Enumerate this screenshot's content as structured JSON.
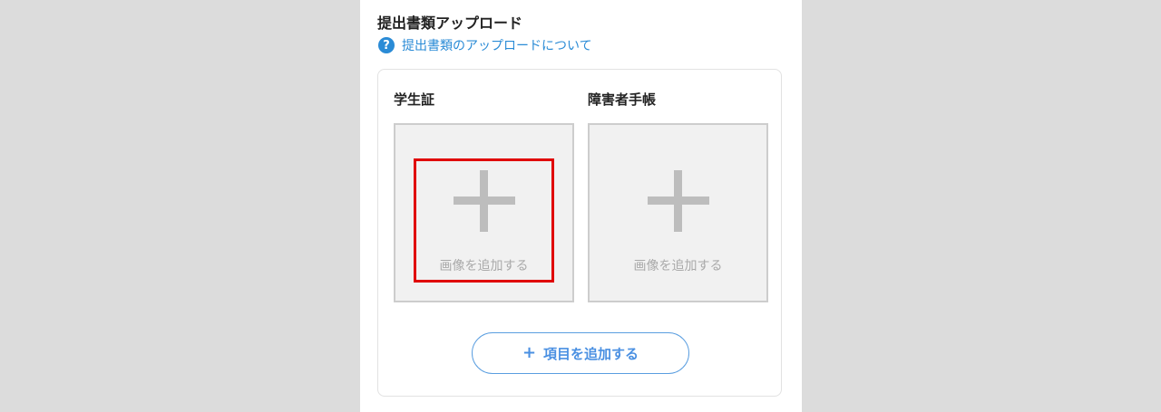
{
  "section": {
    "title": "提出書類アップロード",
    "help_icon_glyph": "?",
    "help_link_text": "提出書類のアップロードについて"
  },
  "documents": [
    {
      "label": "学生証",
      "upload_text": "画像を追加する",
      "highlighted": true
    },
    {
      "label": "障害者手帳",
      "upload_text": "画像を追加する",
      "highlighted": false
    }
  ],
  "add_item": {
    "icon": "+",
    "label": "項目を追加する"
  },
  "colors": {
    "background": "#dcdcdc",
    "accent": "#4a90e2",
    "link": "#2a8bd6",
    "highlight": "#e00000",
    "upload_box_fill": "#f1f1f1"
  },
  "icons": {
    "help": "question-circle-icon",
    "add_image": "plus-icon",
    "add_item": "plus-icon"
  }
}
